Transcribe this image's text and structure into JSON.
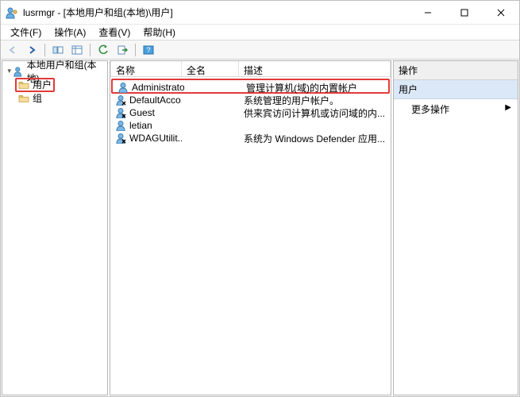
{
  "window": {
    "title": "lusrmgr - [本地用户和组(本地)\\用户]"
  },
  "menu": {
    "file": "文件(F)",
    "action": "操作(A)",
    "view": "查看(V)",
    "help": "帮助(H)"
  },
  "tree": {
    "root": "本地用户和组(本地)",
    "users": "用户",
    "groups": "组"
  },
  "list": {
    "col_name": "名称",
    "col_fullname": "全名",
    "col_desc": "描述",
    "rows": [
      {
        "name": "Administrator",
        "full": "",
        "desc": "管理计算机(域)的内置帐户"
      },
      {
        "name": "DefaultAcco...",
        "full": "",
        "desc": "系统管理的用户帐户。"
      },
      {
        "name": "Guest",
        "full": "",
        "desc": "供来宾访问计算机或访问域的内..."
      },
      {
        "name": "letian",
        "full": "",
        "desc": ""
      },
      {
        "name": "WDAGUtilit...",
        "full": "",
        "desc": "系统为 Windows Defender 应用..."
      }
    ]
  },
  "actions": {
    "header": "操作",
    "section": "用户",
    "more": "更多操作"
  }
}
